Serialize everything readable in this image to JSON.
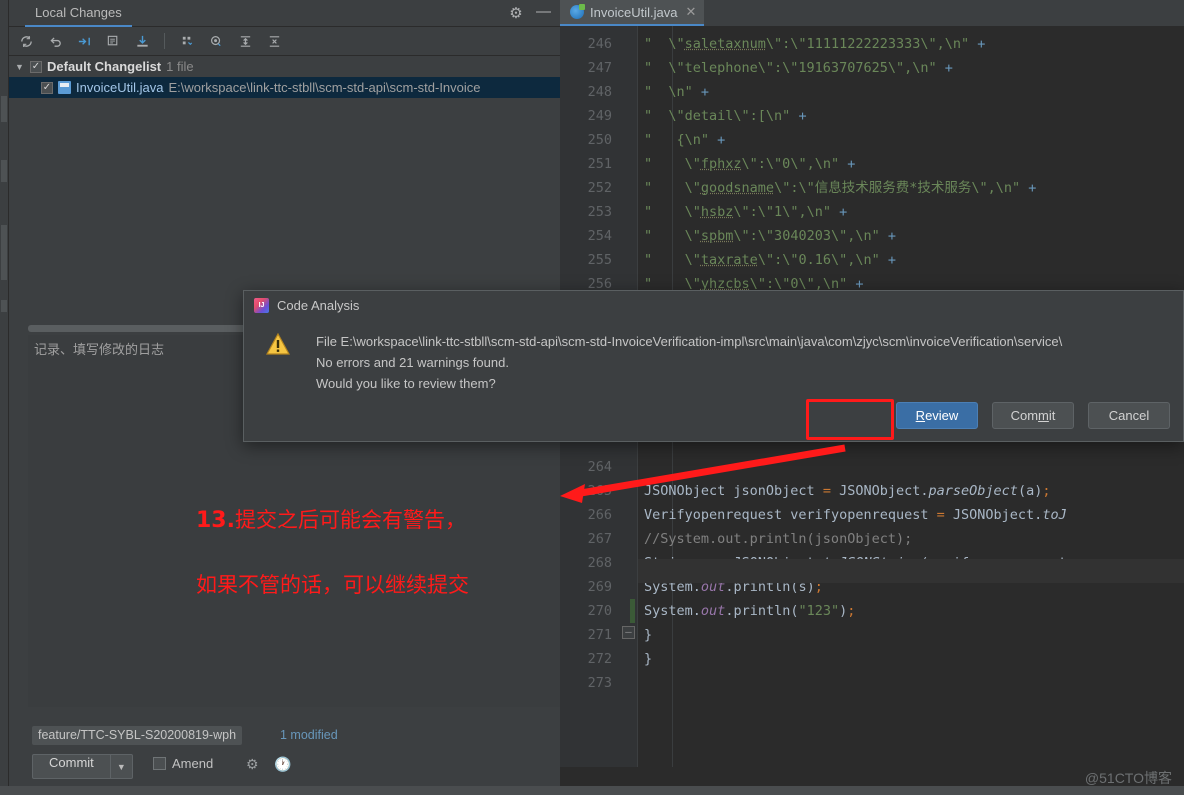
{
  "left_strip": {
    "name": "tool-window-strip"
  },
  "local_changes": {
    "tab_label": "Local Changes",
    "gear_icon": "gear-icon",
    "minimize_icon": "minimize-icon",
    "toolbar": [
      {
        "name": "refresh-icon",
        "glyph": "⟳"
      },
      {
        "name": "rollback-icon",
        "glyph": "↶"
      },
      {
        "name": "show-diff-icon",
        "glyph": "→←"
      },
      {
        "name": "edit-changelist-icon",
        "glyph": "▤"
      },
      {
        "name": "update-project-icon",
        "glyph": "↧"
      },
      {
        "name": "group-by-icon",
        "glyph": "∷"
      },
      {
        "name": "filter-eye-icon",
        "glyph": "◉"
      },
      {
        "name": "expand-all-icon",
        "glyph": "⇥"
      },
      {
        "name": "collapse-all-icon",
        "glyph": "⇤"
      }
    ],
    "changelist": {
      "name": "Default Changelist",
      "count": "1 file",
      "checked": true
    },
    "file": {
      "checked": true,
      "name": "InvoiceUtil.java",
      "path": "E:\\workspace\\link-ttc-stbll\\scm-std-api\\scm-std-Invoice"
    },
    "commit_message_placeholder": "记录、填写修改的日志",
    "commit_message_value": "",
    "branch": "feature/TTC-SYBL-S20200819-wph",
    "modified_label": "1 modified",
    "commit_button": "Commit",
    "commit_dropdown_icon": "chevron-down-icon",
    "amend_label": "Amend",
    "amend_checked": false,
    "settings_icon": "gear-icon",
    "history_icon": "clock-icon"
  },
  "editor": {
    "tab": {
      "label": "InvoiceUtil.java",
      "icon": "java-class-icon",
      "close_icon": "close-icon"
    },
    "lines": [
      {
        "num": "246",
        "html": "<span class=\"s-str\">\"  \\\"</span><span class=\"s-str wavy\">saletaxnum</span><span class=\"s-str\">\\\":\\\"11111222223333\\\",\\n\"</span> <span class=\"s-plus\">+</span>"
      },
      {
        "num": "247",
        "html": "<span class=\"s-str\">\"  \\\"telephone\\\":\\\"19163707625\\\",\\n\"</span> <span class=\"s-plus\">+</span>"
      },
      {
        "num": "248",
        "html": "<span class=\"s-str\">\"  \\n\"</span> <span class=\"s-plus\">+</span>"
      },
      {
        "num": "249",
        "html": "<span class=\"s-str\">\"  \\\"detail\\\":[\\n\"</span> <span class=\"s-plus\">+</span>"
      },
      {
        "num": "250",
        "html": "<span class=\"s-str\">\"   {\\n\"</span> <span class=\"s-plus\">+</span>"
      },
      {
        "num": "251",
        "html": "<span class=\"s-str\">\"    \\\"</span><span class=\"s-str wavy\">fphxz</span><span class=\"s-str\">\\\":\\\"0\\\",\\n\"</span> <span class=\"s-plus\">+</span>"
      },
      {
        "num": "252",
        "html": "<span class=\"s-str\">\"    \\\"</span><span class=\"s-str wavy\">goodsname</span><span class=\"s-str\">\\\":\\\"信息技术服务费*技术服务\\\",\\n\"</span> <span class=\"s-plus\">+</span>"
      },
      {
        "num": "253",
        "html": "<span class=\"s-str\">\"    \\\"</span><span class=\"s-str wavy\">hsbz</span><span class=\"s-str\">\\\":\\\"1\\\",\\n\"</span> <span class=\"s-plus\">+</span>"
      },
      {
        "num": "254",
        "html": "<span class=\"s-str\">\"    \\\"</span><span class=\"s-str wavy\">spbm</span><span class=\"s-str\">\\\":\\\"3040203\\\",\\n\"</span> <span class=\"s-plus\">+</span>"
      },
      {
        "num": "255",
        "html": "<span class=\"s-str\">\"    \\\"</span><span class=\"s-str wavy\">taxrate</span><span class=\"s-str\">\\\":\\\"0.16\\\",\\n\"</span> <span class=\"s-plus\">+</span>"
      },
      {
        "num": "256",
        "html": "<span class=\"s-str\">\"    \\\"</span><span class=\"s-str wavy\">yhzcbs</span><span class=\"s-str\">\\\":\\\"0\\\",\\n\"</span> <span class=\"s-plus\">+</span>"
      }
    ],
    "lines_lower": [
      {
        "num": "264",
        "html": ""
      },
      {
        "num": "265",
        "html": "<span class=\"s-type\">JSONObject</span> jsonObject <span class=\"s-semi\">=</span> <span class=\"s-type\">JSONObject</span>.<span class=\"s-ital\">parseObject</span>(a)<span class=\"s-semi\">;</span>"
      },
      {
        "num": "266",
        "html": "<span class=\"s-type\">Verifyopenrequest</span> verifyopenrequest <span class=\"s-semi\">=</span> <span class=\"s-type\">JSONObject</span>.<span class=\"s-ital\">toJ</span>"
      },
      {
        "num": "267",
        "html": "<span class=\"s-cmt\">//System.out.println(jsonObject);</span>"
      },
      {
        "num": "268",
        "html": "<span class=\"s-type\">String</span> s <span class=\"s-semi\">=</span> <span class=\"s-type\">JSONObject</span>.<span class=\"s-ital\">toJSONString</span>(verifyopenrequest"
      },
      {
        "num": "269",
        "html": "<span class=\"s-type\">System</span>.<span class=\"s-static\">out</span>.println(s)<span class=\"s-semi\">;</span>"
      },
      {
        "num": "270",
        "html": "<span class=\"s-type\">System</span>.<span class=\"s-static\">out</span>.println(<span class=\"s-str\">\"123\"</span>)<span class=\"s-semi\">;</span>"
      },
      {
        "num": "271",
        "html": "}"
      },
      {
        "num": "272",
        "html": "}"
      },
      {
        "num": "273",
        "html": ""
      }
    ]
  },
  "dialog": {
    "title": "Code Analysis",
    "icon": "intellij-idea-icon",
    "warning_icon": "warning-triangle-icon",
    "message_line1": "File E:\\workspace\\link-ttc-stbll\\scm-std-api\\scm-std-InvoiceVerification-impl\\src\\main\\java\\com\\zjyc\\scm\\invoiceVerification\\service\\",
    "message_line2": "No errors and 21 warnings found.",
    "message_line3": "Would you like to review them?",
    "buttons": {
      "review": "Review",
      "review_mnemonic": "R",
      "commit": "Commit",
      "commit_mnemonic": "m",
      "cancel": "Cancel"
    },
    "highlight_color": "#ff1a1a"
  },
  "annotation": {
    "number": "13.",
    "line1": "提交之后可能会有警告，",
    "line2": "如果不管的话，可以继续提交",
    "color": "#ff1a1a"
  },
  "watermark": "@51CTO博客"
}
